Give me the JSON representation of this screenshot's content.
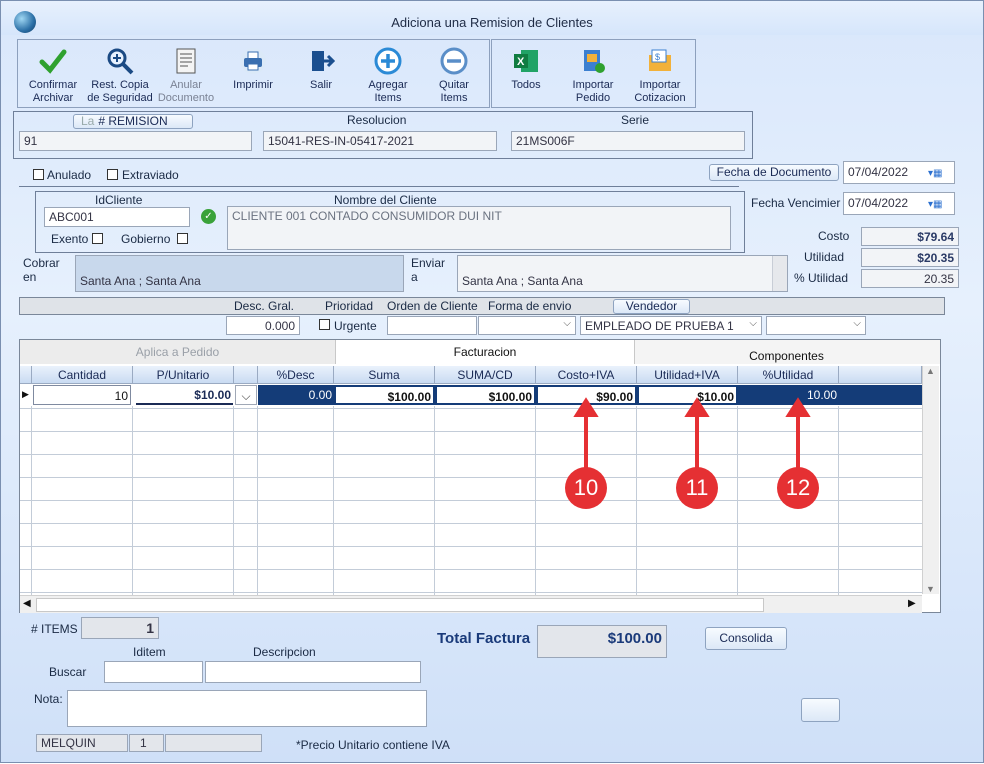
{
  "window": {
    "title": "Adiciona una Remision de Clientes"
  },
  "toolbar": {
    "confirm": "Confirmar\nArchivar",
    "restore": "Rest. Copia\nde Seguridad",
    "void": "Anular\nDocumento",
    "print": "Imprimir",
    "exit": "Salir",
    "add_items": "Agregar\nItems",
    "remove_items": "Quitar\nItems",
    "all": "Todos",
    "import_order": "Importar\nPedido",
    "import_quote": "Importar\nCotizacion"
  },
  "header": {
    "remision_label": "# REMISION",
    "remision_tab_hint": "La",
    "resolucion_label": "Resolucion",
    "serie_label": "Serie",
    "remision_value": "91",
    "resolucion_value": "15041-RES-IN-05417-2021",
    "serie_value": "21MS006F"
  },
  "status": {
    "anulado": "Anulado",
    "extraviado": "Extraviado"
  },
  "dates": {
    "doc_label": "Fecha de  Documento",
    "doc_value": "07/04/2022",
    "venc_label": "Fecha Vencimier",
    "venc_value": "07/04/2022"
  },
  "client": {
    "id_label": "IdCliente",
    "name_label": "Nombre del Cliente",
    "id_value": "ABC001",
    "name_value": "CLIENTE 001 CONTADO CONSUMIDOR DUI NIT",
    "exento": "Exento",
    "gobierno": "Gobierno",
    "cobrar_label": "Cobrar\nen",
    "cobrar_value": "Santa Ana ; Santa Ana",
    "enviar_label": "Enviar\na",
    "enviar_value": "Santa Ana ; Santa Ana"
  },
  "totals_side": {
    "costo_label": "Costo",
    "costo_value": "$79.64",
    "utilidad_label": "Utilidad",
    "utilidad_value": "$20.35",
    "putilidad_label": "% Utilidad",
    "putilidad_value": "20.35"
  },
  "options": {
    "desc_label": "Desc. Gral.",
    "desc_value": "0.000",
    "prioridad_label": "Prioridad",
    "urgente": "Urgente",
    "orden_label": "Orden de Cliente",
    "forma_label": "Forma de envio",
    "vendedor_label": "Vendedor",
    "vendedor_value": "EMPLEADO DE PRUEBA 1"
  },
  "grid": {
    "tabs": [
      "Aplica a Pedido",
      "Facturacion",
      "Componentes"
    ],
    "columns": [
      "Cantidad",
      "P/Unitario",
      "",
      "%Desc",
      "Suma",
      "SUMA/CD",
      "Costo+IVA",
      "Utilidad+IVA",
      "%Utilidad"
    ],
    "row": {
      "cantidad": "10",
      "punitario": "$10.00",
      "desc": "0.00",
      "suma": "$100.00",
      "sumacd": "$100.00",
      "costo": "$90.00",
      "utilidad": "$10.00",
      "putilidad": "10.00"
    }
  },
  "callouts": [
    "10",
    "11",
    "12"
  ],
  "footer": {
    "items_label": "# ITEMS",
    "items_value": "1",
    "iditem_label": "Iditem",
    "descripcion_label": "Descripcion",
    "buscar_label": "Buscar",
    "total_label": "Total Factura",
    "total_value": "$100.00",
    "consolida": "Consolida",
    "nota_label": "Nota:",
    "user": "MELQUIN",
    "user_num": "1",
    "note": "*Precio Unitario contiene IVA"
  },
  "colors": {
    "accent": "#143c78",
    "callout": "#e53033"
  }
}
